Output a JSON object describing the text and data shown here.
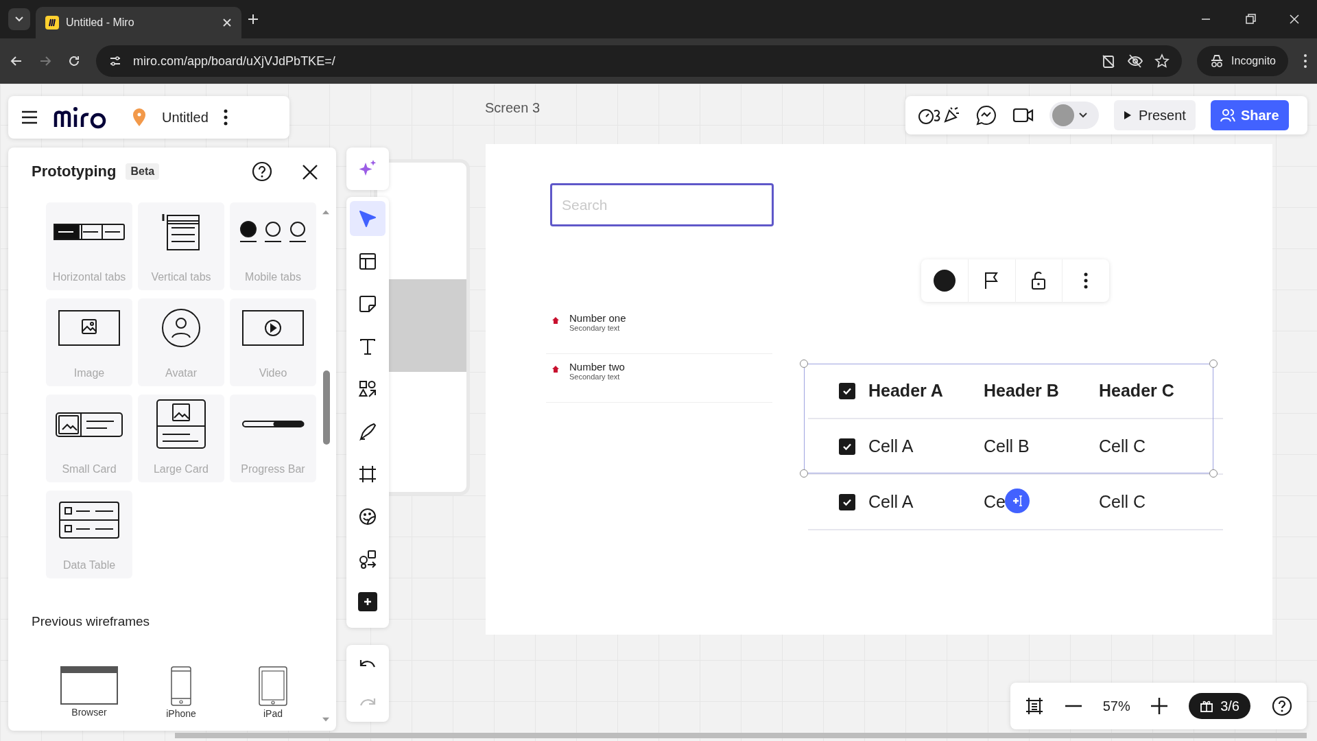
{
  "browser": {
    "tab_title": "Untitled - Miro",
    "url": "miro.com/app/board/uXjVJdPbTKE=/",
    "profile": "Incognito"
  },
  "board": {
    "name": "Untitled",
    "frame_label": "Screen 3"
  },
  "panel": {
    "title": "Prototyping",
    "badge": "Beta",
    "components": [
      {
        "kind": "htabs",
        "label": "Horizontal tabs"
      },
      {
        "kind": "vtabs",
        "label": "Vertical tabs"
      },
      {
        "kind": "mtabs",
        "label": "Mobile tabs"
      },
      {
        "kind": "image",
        "label": "Image"
      },
      {
        "kind": "avatar",
        "label": "Avatar"
      },
      {
        "kind": "video",
        "label": "Video"
      },
      {
        "kind": "smallcard",
        "label": "Small Card"
      },
      {
        "kind": "largecard",
        "label": "Large Card"
      },
      {
        "kind": "progress",
        "label": "Progress Bar"
      },
      {
        "kind": "datatable",
        "label": "Data Table"
      }
    ],
    "section_title": "Previous wireframes",
    "wireframes": [
      {
        "kind": "browser",
        "label": "Browser"
      },
      {
        "kind": "phone",
        "label": "iPhone"
      },
      {
        "kind": "tablet",
        "label": "iPad"
      }
    ]
  },
  "tools": [
    {
      "kind": "cursor",
      "selected": true
    },
    {
      "kind": "layout",
      "selected": false
    },
    {
      "kind": "sticky",
      "selected": false
    },
    {
      "kind": "text",
      "selected": false
    },
    {
      "kind": "shapes",
      "selected": false
    },
    {
      "kind": "pen",
      "selected": false
    },
    {
      "kind": "frame",
      "selected": false
    },
    {
      "kind": "sticker",
      "selected": false
    },
    {
      "kind": "diagram",
      "selected": false
    },
    {
      "kind": "more",
      "selected": false
    }
  ],
  "topbar": {
    "present": "Present",
    "share": "Share"
  },
  "frame": {
    "search_placeholder": "Search",
    "list": [
      {
        "primary": "Number one",
        "secondary": "Secondary text"
      },
      {
        "primary": "Number two",
        "secondary": "Secondary text"
      }
    ],
    "table": {
      "header_checked": true,
      "columns": [
        "Header A",
        "Header B",
        "Header C"
      ],
      "rows": [
        {
          "checked": true,
          "cells": [
            "Cell A",
            "Cell B",
            "Cell C"
          ]
        },
        {
          "checked": true,
          "cells": [
            "Cell A",
            "Ce",
            "Cell C"
          ]
        }
      ]
    }
  },
  "zoom": {
    "level": "57%",
    "tour": "3/6"
  }
}
